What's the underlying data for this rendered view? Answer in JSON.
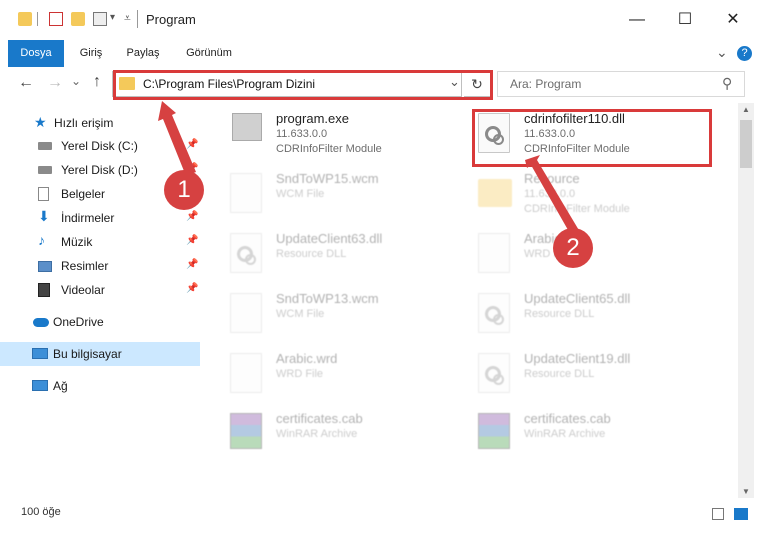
{
  "window": {
    "title": "Program",
    "minimize": "—",
    "maximize": "☐",
    "close": "✕"
  },
  "ribbon": {
    "tabs": [
      "Dosya",
      "Giriş",
      "Paylaş",
      "Görünüm"
    ],
    "expand": "⌄",
    "help": "?"
  },
  "nav": {
    "back": "←",
    "forward": "→",
    "recent": "⌄",
    "up": "↑",
    "address": "C:\\Program Files\\Program Dizini",
    "address_dropdown": "⌄",
    "refresh": "↻",
    "search_placeholder": "Ara: Program",
    "search_icon": "⚲"
  },
  "sidebar": {
    "items": [
      {
        "label": "Hızlı erişim",
        "icon": "star-icon",
        "pinned": false
      },
      {
        "label": "Yerel Disk (C:)",
        "icon": "drive-icon",
        "pinned": true
      },
      {
        "label": "Yerel Disk (D:)",
        "icon": "drive-icon",
        "pinned": true
      },
      {
        "label": "Belgeler",
        "icon": "documents-icon",
        "pinned": true
      },
      {
        "label": "İndirmeler",
        "icon": "download-icon",
        "pinned": true
      },
      {
        "label": "Müzik",
        "icon": "music-icon",
        "pinned": true
      },
      {
        "label": "Resimler",
        "icon": "pictures-icon",
        "pinned": true
      },
      {
        "label": "Videolar",
        "icon": "video-icon",
        "pinned": true
      },
      {
        "label": "OneDrive",
        "icon": "cloud-icon",
        "pinned": false
      },
      {
        "label": "Bu bilgisayar",
        "icon": "computer-icon",
        "pinned": false,
        "selected": true
      },
      {
        "label": "Ağ",
        "icon": "network-icon",
        "pinned": false
      }
    ]
  },
  "files": [
    {
      "name": "program.exe",
      "line1": "11.633.0.0",
      "line2": "CDRInfoFilter Module",
      "type": "exe",
      "highlighted": false
    },
    {
      "name": "cdrinfofilter110.dll",
      "line1": "11.633.0.0",
      "line2": "CDRInfoFilter Module",
      "type": "dll",
      "highlighted": true
    },
    {
      "name": "SndToWP15.wcm",
      "line1": "WCM File",
      "line2": "",
      "type": "doc",
      "highlighted": false
    },
    {
      "name": "Resource",
      "line1": "11.633.0.0",
      "line2": "CDRInfoFilter Module",
      "type": "folder",
      "highlighted": false
    },
    {
      "name": "UpdateClient63.dll",
      "line1": "Resource DLL",
      "line2": "",
      "type": "dll",
      "highlighted": false
    },
    {
      "name": "Arabic.wrd",
      "line1": "WRD File",
      "line2": "",
      "type": "doc",
      "highlighted": false
    },
    {
      "name": "SndToWP13.wcm",
      "line1": "WCM File",
      "line2": "",
      "type": "doc",
      "highlighted": false
    },
    {
      "name": "UpdateClient65.dll",
      "line1": "Resource DLL",
      "line2": "",
      "type": "dll",
      "highlighted": false
    },
    {
      "name": "Arabic.wrd",
      "line1": "WRD File",
      "line2": "",
      "type": "doc",
      "highlighted": false
    },
    {
      "name": "UpdateClient19.dll",
      "line1": "Resource DLL",
      "line2": "",
      "type": "dll",
      "highlighted": false
    },
    {
      "name": "certificates.cab",
      "line1": "WinRAR Archive",
      "line2": "",
      "type": "rar",
      "highlighted": false
    },
    {
      "name": "certificates.cab",
      "line1": "WinRAR Archive",
      "line2": "",
      "type": "rar",
      "highlighted": false
    }
  ],
  "status": {
    "count": "100 öğe"
  },
  "annotations": {
    "marker1": "1",
    "marker2": "2",
    "color": "#d93a3a"
  },
  "colors": {
    "accent": "#1979ca",
    "selected_bg": "#cce8ff",
    "annotation": "#d93a3a"
  }
}
